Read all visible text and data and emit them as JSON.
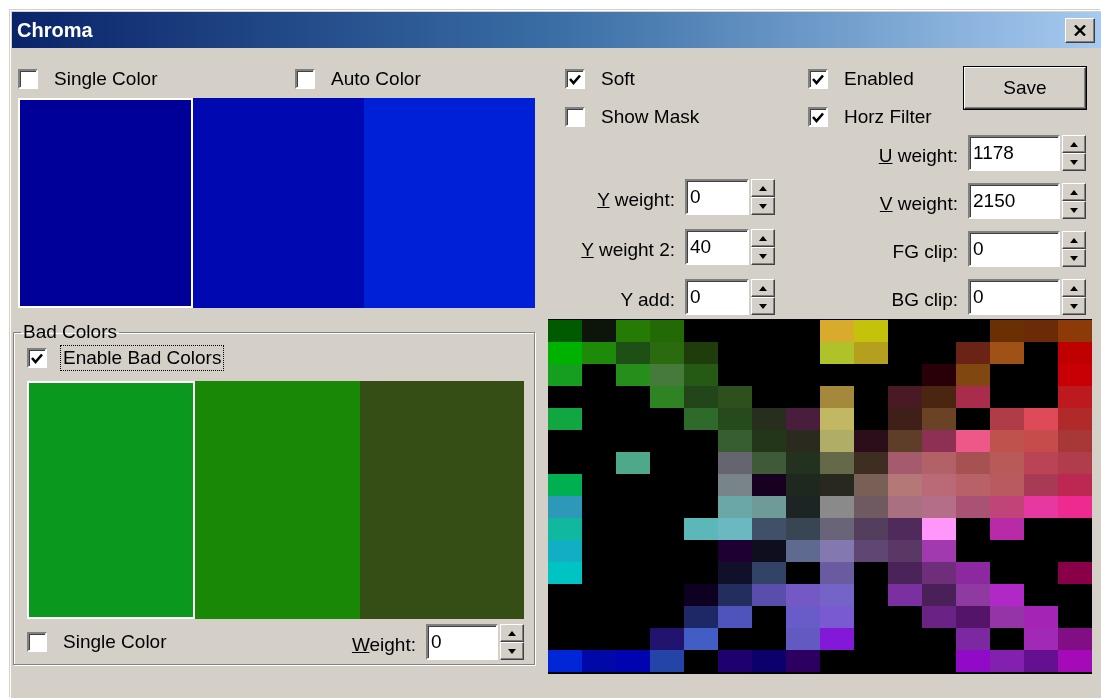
{
  "window": {
    "title": "Chroma"
  },
  "key_colors": {
    "checkboxes": [
      {
        "label": "Single Color",
        "checked": false
      },
      {
        "label": "Auto Color",
        "checked": false
      }
    ],
    "swatches": [
      {
        "color": "#000098",
        "selected": true
      },
      {
        "color": "#0009b1",
        "selected": false
      },
      {
        "color": "#0020d8",
        "selected": false
      }
    ]
  },
  "options": [
    {
      "label": "Soft",
      "checked": true
    },
    {
      "label": "Show Mask",
      "checked": false
    },
    {
      "label": "Enabled",
      "checked": true
    },
    {
      "label": "Horz Filter",
      "checked": true
    }
  ],
  "save_button": "Save",
  "y_fields": [
    {
      "label": "Y weight:",
      "value": "0",
      "mnemonic_underlined": true
    },
    {
      "label": "Y weight 2:",
      "value": "40",
      "mnemonic_underlined": true
    },
    {
      "label": "Y add:",
      "value": "0",
      "mnemonic_underlined": false
    }
  ],
  "uv_fields": [
    {
      "label": "U weight:",
      "value": "1178",
      "mnemonic_underlined": true
    },
    {
      "label": "V weight:",
      "value": "2150",
      "mnemonic_underlined": true
    },
    {
      "label": "FG clip:",
      "value": "0",
      "mnemonic_underlined": false
    },
    {
      "label": "BG clip:",
      "value": "0",
      "mnemonic_underlined": false
    }
  ],
  "bad_colors": {
    "title": "Bad Colors",
    "enable": {
      "label": "Enable Bad Colors",
      "checked": true,
      "focused": true
    },
    "swatches": [
      {
        "color": "#0a981e",
        "selected": true
      },
      {
        "color": "#188806",
        "selected": false
      },
      {
        "color": "#354e16",
        "selected": false
      }
    ],
    "single_color": {
      "label": "Single Color",
      "checked": false
    },
    "weight": {
      "label": "Weight:",
      "value": "0",
      "mnemonic_underlined": true
    }
  }
}
